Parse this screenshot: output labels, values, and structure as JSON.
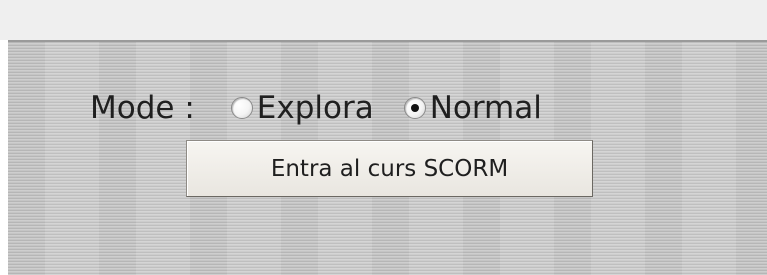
{
  "mode": {
    "label": "Mode :",
    "options": [
      {
        "label": "Explora",
        "selected": false
      },
      {
        "label": "Normal",
        "selected": true
      }
    ]
  },
  "enter_button": {
    "label": "Entra al curs SCORM"
  }
}
